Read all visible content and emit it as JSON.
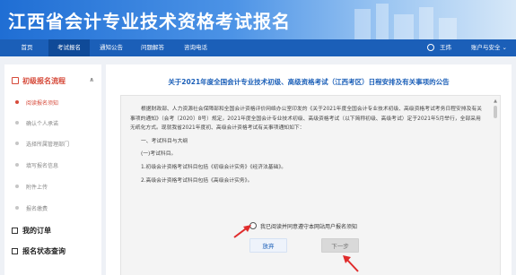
{
  "header": {
    "title": "江西省会计专业技术资格考试报名"
  },
  "nav": {
    "items": [
      {
        "label": "首页"
      },
      {
        "label": "考试报名"
      },
      {
        "label": "通知公告"
      },
      {
        "label": "问题解答"
      },
      {
        "label": "咨询电话"
      }
    ],
    "active_index": 1,
    "user_name": "王炜",
    "account_menu": "账户与安全 ⌄"
  },
  "sidebar": {
    "section_title": "初级报名流程",
    "steps": [
      {
        "label": "阅读报名须知"
      },
      {
        "label": "确认个人承诺"
      },
      {
        "label": "选择所属管理部门"
      },
      {
        "label": "填写报名信息"
      },
      {
        "label": "附件上传"
      },
      {
        "label": "报名缴费"
      }
    ],
    "active_step": 0,
    "links": [
      {
        "label": "我的订单"
      },
      {
        "label": "报名状态查询"
      }
    ]
  },
  "notice": {
    "title": "关于2021年度全国会计专业技术初级、高级资格考试（江西考区）日程安排及有关事项的公告",
    "paragraphs": [
      "根据财政部、人力资源社会保障部和全国会计资格评价网络办公室印发的《关于2021年度全国会计专业技术初级、高级资格考试考务日程安排及有关事项的通知》（会考〔2020〕8号）规定，2021年度全国会计专业技术初级、高级资格考试（以下简称初级、高级考试）定于2021年5月举行，全部采用无纸化方式。现就我省2021年度初、高级会计资格考试有关事项通知如下：",
      "一、考试科目与大纲",
      "(一)考试科目。",
      "1.初级会计资格考试科目包括《初级会计实务》《经济法基础》。",
      "2.高级会计资格考试科目包括《高级会计实务》。"
    ]
  },
  "agreement": {
    "label": "我已阅读并同意遵守本网站用户报名须知"
  },
  "buttons": {
    "give_up": "放弃",
    "next": "下一步"
  },
  "colors": {
    "brand": "#1b5fb8",
    "accent": "#d64a3a",
    "arrow": "#e02b2b"
  }
}
